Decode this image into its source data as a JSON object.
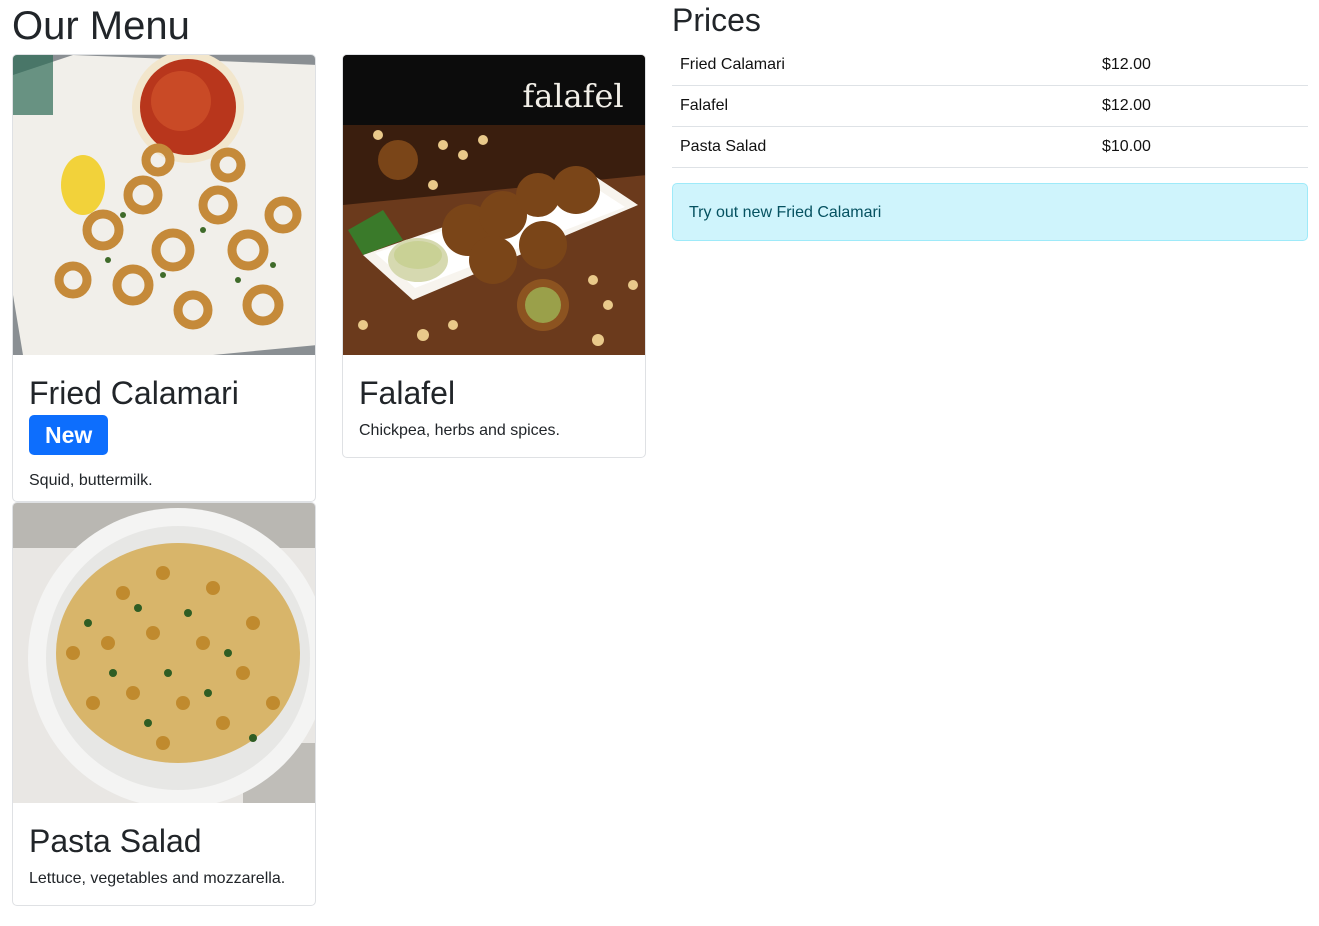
{
  "page": {
    "title": "Our Menu"
  },
  "menu": {
    "items": [
      {
        "name": "Fried Calamari",
        "badge": "New",
        "description": "Squid, buttermilk."
      },
      {
        "name": "Falafel",
        "description": "Chickpea, herbs and spices.",
        "photo_caption": "falafel"
      },
      {
        "name": "Pasta Salad",
        "description": "Lettuce, vegetables and mozzarella."
      }
    ]
  },
  "prices": {
    "title": "Prices",
    "rows": [
      {
        "item": "Fried Calamari",
        "price": "$12.00"
      },
      {
        "item": "Falafel",
        "price": "$12.00"
      },
      {
        "item": "Pasta Salad",
        "price": "$10.00"
      }
    ]
  },
  "alert": {
    "text": "Try out new Fried Calamari"
  },
  "colors": {
    "badge": "#0d6efd",
    "alert_bg": "#cff4fc",
    "alert_text": "#055160"
  }
}
